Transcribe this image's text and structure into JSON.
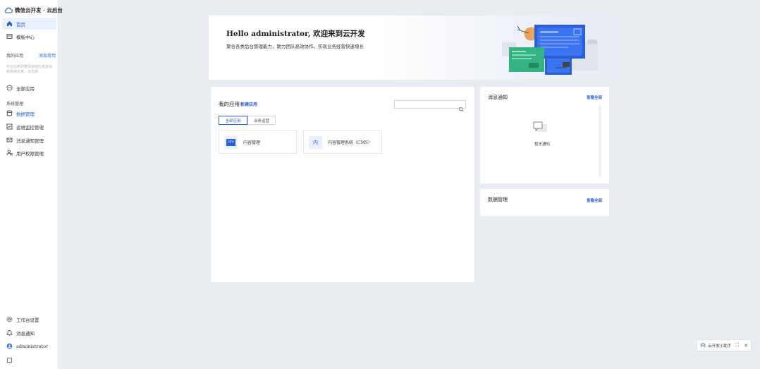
{
  "brand": {
    "name": "微信云开发 · 云后台"
  },
  "sidebar": {
    "top_items": [
      {
        "label": "首页",
        "icon": "home-icon"
      },
      {
        "label": "模板中心",
        "icon": "template-icon"
      }
    ],
    "my_apps_title": "我的应用",
    "add_app_link": "添加常用",
    "hint": "可在应用列表页面将应用添加到常用应用，点击即",
    "all_apps_label": "全部应用",
    "system_title": "系统管理",
    "system_items": [
      {
        "label": "数据管理",
        "icon": "database-icon"
      },
      {
        "label": "运维监控管理",
        "icon": "monitor-icon"
      },
      {
        "label": "消息通知管理",
        "icon": "mail-icon"
      },
      {
        "label": "用户权限管理",
        "icon": "user-permission-icon"
      }
    ],
    "bottom_items": [
      {
        "label": "工作台设置",
        "icon": "gear-icon"
      },
      {
        "label": "消息通知",
        "icon": "bell-icon"
      },
      {
        "label": "administrator",
        "icon": "avatar-icon"
      }
    ]
  },
  "banner": {
    "title": "Hello administrator, 欢迎来到云开发",
    "subtitle": "聚合各类后台管理能力，助力团队高效协作，实现业务经营快速增长"
  },
  "apps": {
    "title": "我的应用",
    "new_link": "新建应用",
    "search_placeholder": "",
    "tabs": [
      "全部应用",
      "业务运营"
    ],
    "cards": [
      {
        "icon_text": "cms",
        "label": "内容管理"
      },
      {
        "icon_text": "内",
        "label": "内容管理系统（CMS）"
      }
    ]
  },
  "notice": {
    "title": "消息通知",
    "link": "查看全部",
    "empty_label": "暂无通知"
  },
  "datamgmt": {
    "title": "数据管理",
    "link": "查看全部"
  },
  "assistant": {
    "label": "云开发小助手"
  },
  "colors": {
    "accent": "#2a62d6",
    "background": "#e9edf2",
    "active_bg": "#eaf1fe"
  }
}
